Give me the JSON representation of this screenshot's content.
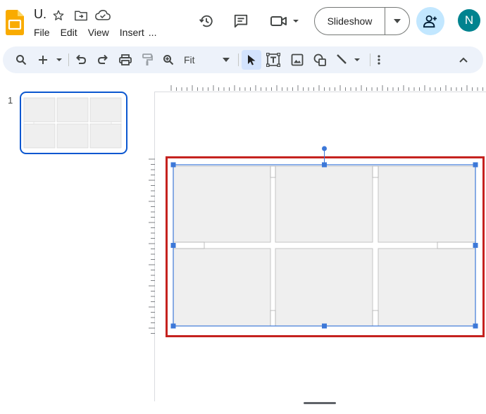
{
  "header": {
    "doc_title": "U.",
    "menus": [
      "File",
      "Edit",
      "View",
      "Insert",
      "..."
    ],
    "icons": {
      "logo": "slides-logo-icon",
      "star": "star-icon",
      "move": "move-to-folder-icon",
      "cloud": "cloud-saved-icon",
      "history": "history-icon",
      "comments": "comment-icon",
      "meet": "video-camera-icon",
      "share": "add-person-icon"
    },
    "slideshow_label": "Slideshow",
    "avatar_initial": "N"
  },
  "toolbar": {
    "zoom_value": "Fit",
    "icons": [
      "search-icon",
      "add-icon",
      "undo-icon",
      "redo-icon",
      "print-icon",
      "paint-format-icon",
      "zoom-icon",
      "select-icon",
      "text-box-icon",
      "image-icon",
      "shape-icon",
      "line-icon",
      "more-icon",
      "collapse-icon"
    ]
  },
  "filmstrip": {
    "slides": [
      {
        "number": "1"
      }
    ]
  },
  "colors": {
    "accent": "#0b57d0",
    "selection_handle": "#3c78d8",
    "highlight": "#c5221f",
    "toolbar_bg": "#edf2fa",
    "share_bg": "#c2e7ff",
    "avatar_bg": "#00838f",
    "placeholder_fill": "#efefef"
  }
}
